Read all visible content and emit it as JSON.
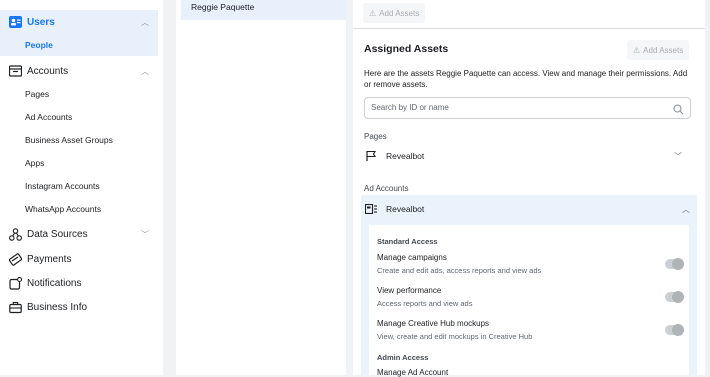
{
  "sidebar": {
    "users": {
      "label": "Users",
      "sub": [
        {
          "label": "People"
        }
      ]
    },
    "accounts": {
      "label": "Accounts",
      "sub": [
        {
          "label": "Pages"
        },
        {
          "label": "Ad Accounts"
        },
        {
          "label": "Business Asset Groups"
        },
        {
          "label": "Apps"
        },
        {
          "label": "Instagram Accounts"
        },
        {
          "label": "WhatsApp Accounts"
        }
      ]
    },
    "data_sources": {
      "label": "Data Sources"
    },
    "payments": {
      "label": "Payments"
    },
    "notifications": {
      "label": "Notifications"
    },
    "business_info": {
      "label": "Business Info"
    }
  },
  "people": {
    "selected": "Reggie Paquette"
  },
  "detail": {
    "add_assets_top": "Add Assets",
    "assigned_title": "Assigned Assets",
    "add_assets": "Add Assets",
    "description": "Here are the assets Reggie Paquette can access. View and manage their permissions. Add or remove assets.",
    "search_placeholder": "Search by ID or name",
    "pages_label": "Pages",
    "page_name": "Revealbot",
    "ad_accounts_label": "Ad Accounts",
    "ad_account_name": "Revealbot",
    "standard_access": "Standard Access",
    "permissions": [
      {
        "title": "Manage campaigns",
        "desc": "Create and edit ads, access reports and view ads"
      },
      {
        "title": "View performance",
        "desc": "Access reports and view ads"
      },
      {
        "title": "Manage Creative Hub mockups",
        "desc": "View, create and edit mockups in Creative Hub"
      }
    ],
    "admin_access": "Admin Access",
    "admin_perm": "Manage Ad Account"
  },
  "colors": {
    "accent": "#1877f2",
    "selected_bg": "#e7f0fb",
    "page_bg": "#f0f2f5"
  }
}
